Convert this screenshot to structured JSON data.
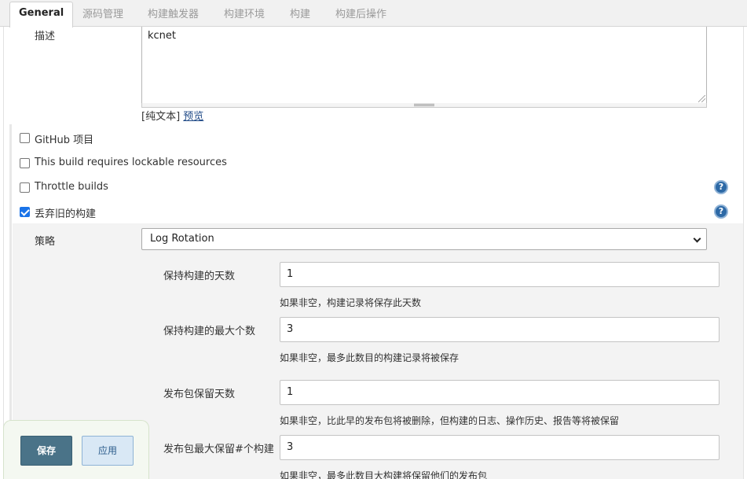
{
  "tabs": [
    {
      "label": "General",
      "active": true
    },
    {
      "label": "源码管理"
    },
    {
      "label": "构建触发器"
    },
    {
      "label": "构建环境"
    },
    {
      "label": "构建"
    },
    {
      "label": "构建后操作"
    }
  ],
  "description": {
    "label": "描述",
    "value": "kcnet",
    "markup_prefix": "[纯文本]",
    "preview_link": "预览"
  },
  "options": [
    {
      "label": "GitHub 项目",
      "checked": false
    },
    {
      "label": "This build requires lockable resources",
      "checked": false
    },
    {
      "label": "Throttle builds",
      "checked": false
    },
    {
      "label": "丢弃旧的构建",
      "checked": true
    }
  ],
  "help_icon_glyph": "?",
  "strategy": {
    "label": "策略",
    "selected": "Log Rotation"
  },
  "fields": [
    {
      "label": "保持构建的天数",
      "value": "1",
      "hint": "如果非空，构建记录将保存此天数"
    },
    {
      "label": "保持构建的最大个数",
      "value": "3",
      "hint": "如果非空，最多此数目的构建记录将被保存"
    },
    {
      "label": "发布包保留天数",
      "value": "1",
      "hint": "如果非空，比此早的发布包将被删除，但构建的日志、操作历史、报告等将被保留"
    },
    {
      "label": "发布包最大保留#个构建",
      "value": "3",
      "hint": "如果非空，最多此数目大构建将保留他们的发布包"
    }
  ],
  "buttons": {
    "save": "保存",
    "apply": "应用"
  },
  "colors": {
    "checkbox_checked": "#1a73e8",
    "help_icon": "#2d69a6",
    "save_button": "#4a7388",
    "apply_button": "#d9e8f5"
  }
}
